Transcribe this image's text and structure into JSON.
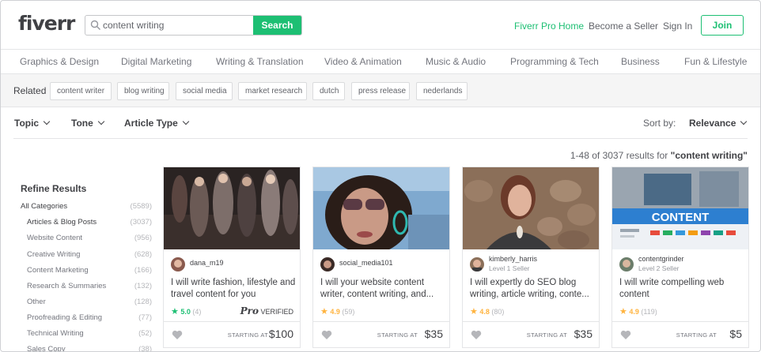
{
  "header": {
    "logo": "fiverr",
    "search_value": "content writing",
    "search_button": "Search",
    "nav": [
      "Fiverr Pro Home",
      "Become a Seller",
      "Sign In"
    ],
    "join": "Join"
  },
  "categories": [
    "Graphics & Design",
    "Digital Marketing",
    "Writing & Translation",
    "Video & Animation",
    "Music & Audio",
    "Programming & Tech",
    "Business",
    "Fun & Lifestyle"
  ],
  "related": {
    "label": "Related",
    "tags": [
      "content writer",
      "blog writing",
      "social media",
      "market research",
      "dutch",
      "press release",
      "nederlands"
    ]
  },
  "filters": [
    "Topic",
    "Tone",
    "Article Type"
  ],
  "sort": {
    "label": "Sort by:",
    "value": "Relevance"
  },
  "results": {
    "prefix": "1-48 of 3037 results for ",
    "query": "\"content writing\""
  },
  "sidebar": {
    "title": "Refine Results",
    "items": [
      {
        "label": "All Categories",
        "count": "(5589)"
      },
      {
        "label": "Articles & Blog Posts",
        "count": "(3037)"
      },
      {
        "label": "Website Content",
        "count": "(956)"
      },
      {
        "label": "Creative Writing",
        "count": "(628)"
      },
      {
        "label": "Content Marketing",
        "count": "(166)"
      },
      {
        "label": "Research & Summaries",
        "count": "(132)"
      },
      {
        "label": "Other",
        "count": "(128)"
      },
      {
        "label": "Proofreading & Editing",
        "count": "(77)"
      },
      {
        "label": "Technical Writing",
        "count": "(52)"
      },
      {
        "label": "Sales Copy",
        "count": "(38)"
      }
    ]
  },
  "gigs": [
    {
      "seller": "dana_m19",
      "level": "",
      "title": "I will write fashion, lifestyle and travel content for you",
      "rating": "5.0",
      "reviews": "(4)",
      "star_color": "#1dbf73",
      "pro_badge": "Pro",
      "pro_verified": "VERIFIED",
      "starting": "STARTING AT",
      "price": "$100"
    },
    {
      "seller": "social_media101",
      "level": "",
      "title": "I will your website content writer, content writing, and...",
      "rating": "4.9",
      "reviews": "(59)",
      "star_color": "#ffb33e",
      "starting": "STARTING AT",
      "price": "$35"
    },
    {
      "seller": "kimberly_harris",
      "level": "Level 1 Seller",
      "title": "I will expertly do SEO blog writing, article writing, conte...",
      "rating": "4.8",
      "reviews": "(80)",
      "star_color": "#ffb33e",
      "starting": "STARTING AT",
      "price": "$35"
    },
    {
      "seller": "contentgrinder",
      "level": "Level 2 Seller",
      "title": "I will write compelling web content",
      "rating": "4.9",
      "reviews": "(119)",
      "star_color": "#ffb33e",
      "starting": "STARTING AT",
      "price": "$5"
    }
  ],
  "colors": {
    "brand": "#1dbf73",
    "star_gold": "#ffb33e",
    "text": "#404145"
  },
  "card4_image_text": "CONTENT"
}
